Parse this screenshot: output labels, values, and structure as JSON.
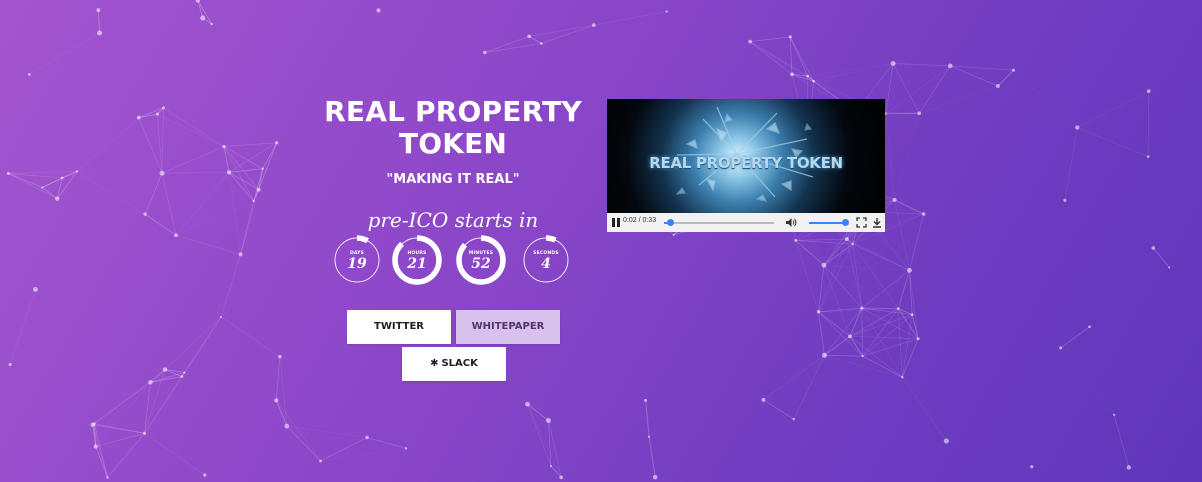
{
  "hero": {
    "title_line1": "REAL PROPERTY",
    "title_line2": "TOKEN",
    "tagline": "\"MAKING IT REAL\"",
    "countdown_heading": "pre-ICO starts in"
  },
  "countdown": [
    {
      "label": "DAYS",
      "value": "19",
      "progress": 0.08
    },
    {
      "label": "HOURS",
      "value": "21",
      "progress": 0.88
    },
    {
      "label": "MINUTES",
      "value": "52",
      "progress": 0.87
    },
    {
      "label": "SECONDS",
      "value": "4",
      "progress": 0.07
    }
  ],
  "buttons": {
    "twitter": "TWITTER",
    "whitepaper": "WHITEPAPER",
    "slack": "SLACK"
  },
  "video": {
    "title": "REAL PROPERTY TOKEN",
    "time_display": "0:02 / 0:33",
    "played_fraction": 0.06,
    "volume_fraction": 0.95
  },
  "colors": {
    "bg_start": "#a455cf",
    "bg_end": "#5f36bb",
    "accent_blue": "#3b82f6",
    "whitepaper_bg": "#d9c1ee"
  },
  "icons": {
    "slack": "slack-hash-icon",
    "pause": "pause-icon",
    "volume": "volume-icon",
    "fullscreen": "fullscreen-icon",
    "download": "download-icon"
  }
}
